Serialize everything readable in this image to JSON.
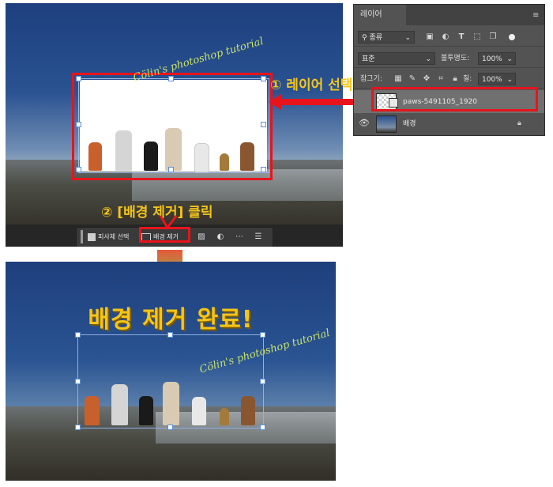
{
  "top_canvas": {
    "watermark": "Cölin's photoshop tutorial",
    "taskbar": {
      "select_subject_label": "피사체 선택",
      "remove_bg_label": "배경 제거"
    }
  },
  "annotations": {
    "step1": "① 레이어 선택",
    "step2": "② [배경 제거] 클릭"
  },
  "layers_panel": {
    "tab_label": "레이어",
    "filter_label": "종류",
    "blend_mode": "표준",
    "opacity_label": "불투명도:",
    "opacity_value": "100%",
    "lock_label": "잠그기:",
    "fill_label": "칠:",
    "fill_value": "100%",
    "layers": [
      {
        "name": "paws-5491105_1920",
        "selected": true
      },
      {
        "name": "배경",
        "locked": true
      }
    ]
  },
  "bottom_canvas": {
    "title": "배경 제거 완료!",
    "watermark": "Cölin's photoshop tutorial"
  },
  "colors": {
    "highlight_red": "#e8141c",
    "annotation_yellow": "#f5c518",
    "panel_bg": "#535353",
    "selected_layer": "#707070"
  }
}
